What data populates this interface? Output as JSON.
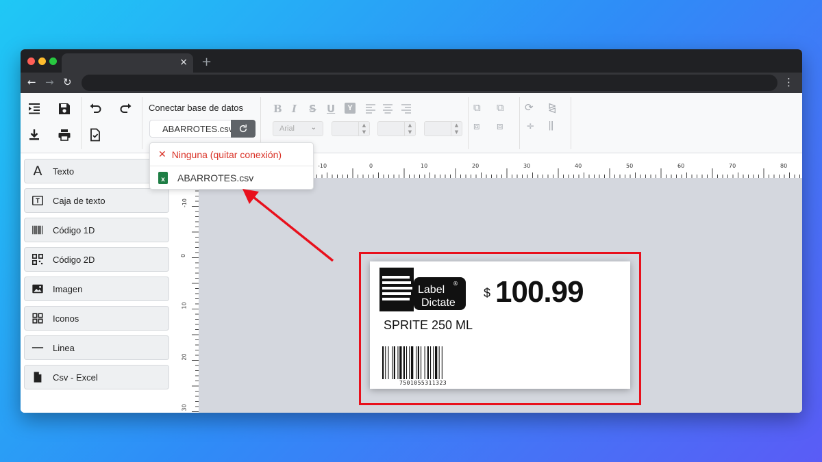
{
  "browser": {
    "tab_close": "×",
    "tab_new": "+",
    "nav_back": "←",
    "nav_forward": "→",
    "nav_reload": "↻",
    "menu": "⋮"
  },
  "toolbar": {
    "db_label": "Conectar base de datos",
    "db_selected": "ABARROTES.csv",
    "font_name": "Arial",
    "format_buttons": [
      "B",
      "I",
      "S",
      "U",
      "Y"
    ]
  },
  "dropdown": {
    "none_option": "Ninguna (quitar conexión)",
    "file_option": "ABARROTES.csv"
  },
  "sidebar": {
    "items": [
      {
        "label": "Texto",
        "icon": "text-icon"
      },
      {
        "label": "Caja de texto",
        "icon": "textbox-icon"
      },
      {
        "label": "Código 1D",
        "icon": "barcode-icon"
      },
      {
        "label": "Código 2D",
        "icon": "qrcode-icon"
      },
      {
        "label": "Imagen",
        "icon": "image-icon"
      },
      {
        "label": "Iconos",
        "icon": "grid-icon"
      },
      {
        "label": "Linea",
        "icon": "line-icon"
      },
      {
        "label": "Csv - Excel",
        "icon": "file-icon"
      }
    ]
  },
  "ruler": {
    "top_labels": [
      "-10",
      "0",
      "10",
      "20",
      "30",
      "40",
      "50",
      "60",
      "70",
      "80"
    ],
    "left_labels": [
      "-10",
      "0",
      "10",
      "20",
      "30"
    ]
  },
  "label": {
    "logo_line1": "Label",
    "logo_line2": "Dictate",
    "logo_mark": "®",
    "currency": "$",
    "price": "100.99",
    "product": "SPRITE 250 ML",
    "barcode_number": "7501055311323"
  },
  "colors": {
    "highlight": "#e8101c",
    "dropdown_none": "#d93025",
    "excel_green": "#1e7e45"
  }
}
